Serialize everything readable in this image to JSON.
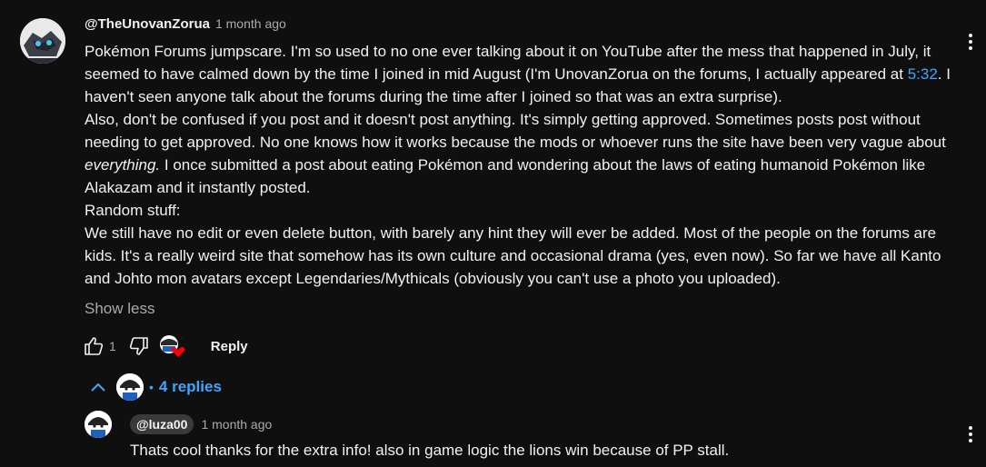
{
  "comment": {
    "handle": "@TheUnovanZorua",
    "time": "1 month ago",
    "text_p1_before": "Pokémon Forums jumpscare. I'm so used to no one ever talking about it on YouTube after the mess that happened in July, it seemed to have calmed down by the time I joined in mid August (I'm UnovanZorua on the forums, I actually appeared at ",
    "timestamp_link": "5:32",
    "text_p1_after": ". I haven't seen anyone talk about the forums during the time after I joined so that was an extra surprise).",
    "text_p2_before": "Also, don't be confused if you post and it doesn't post anything. It's simply getting approved. Sometimes posts post without needing to get approved. No one knows how it works because the mods or whoever runs the site have been very vague about ",
    "text_p2_emph": "everything.",
    "text_p2_after": " I once submitted a post about eating Pokémon and wondering about the laws of eating humanoid Pokémon like Alakazam and it instantly posted.",
    "text_p3": "Random stuff:",
    "text_p4": "We still have no edit or even delete button, with barely any hint they will ever be added. Most of the people on the forums are kids. It's a really weird site that somehow has its own culture and occasional drama (yes, even now). So far we have all Kanto and Johto mon avatars except Legendaries/Mythicals (obviously you can't use a photo you uploaded).",
    "show_less": "Show less",
    "like_count": "1",
    "reply_label": "Reply"
  },
  "replies_toggle": {
    "separator": "•",
    "label": "4 replies"
  },
  "reply": {
    "handle": "@luza00",
    "time": "1 month ago",
    "text": "Thats cool thanks for the extra info! also in game logic the lions win because of PP stall."
  },
  "icons": {
    "more": "more-vert-icon",
    "like": "thumb-up-icon",
    "dislike": "thumb-down-icon",
    "creator_heart": "creator-heart-icon",
    "chevron": "chevron-up-icon"
  },
  "colors": {
    "background": "#0f0f0f",
    "text": "#f1f1f1",
    "secondary": "#aaaaaa",
    "link": "#3ea6ff",
    "heart": "#ff0000"
  }
}
